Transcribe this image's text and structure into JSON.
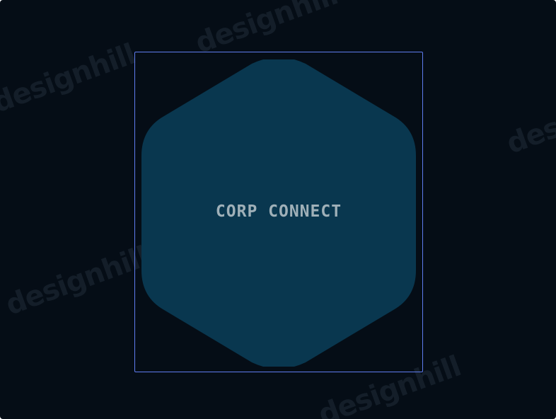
{
  "logo": {
    "name": "CORP CONNECT",
    "shape": "rounded-hexagon",
    "fill_color": "#09374f",
    "text_color": "#9fb0b8"
  },
  "canvas": {
    "background_color": "#050d16"
  },
  "selection": {
    "border_color": "#5f7cf0"
  },
  "watermarks": [
    "designhill",
    "designhill",
    "designhill",
    "designhill",
    "designhill"
  ]
}
